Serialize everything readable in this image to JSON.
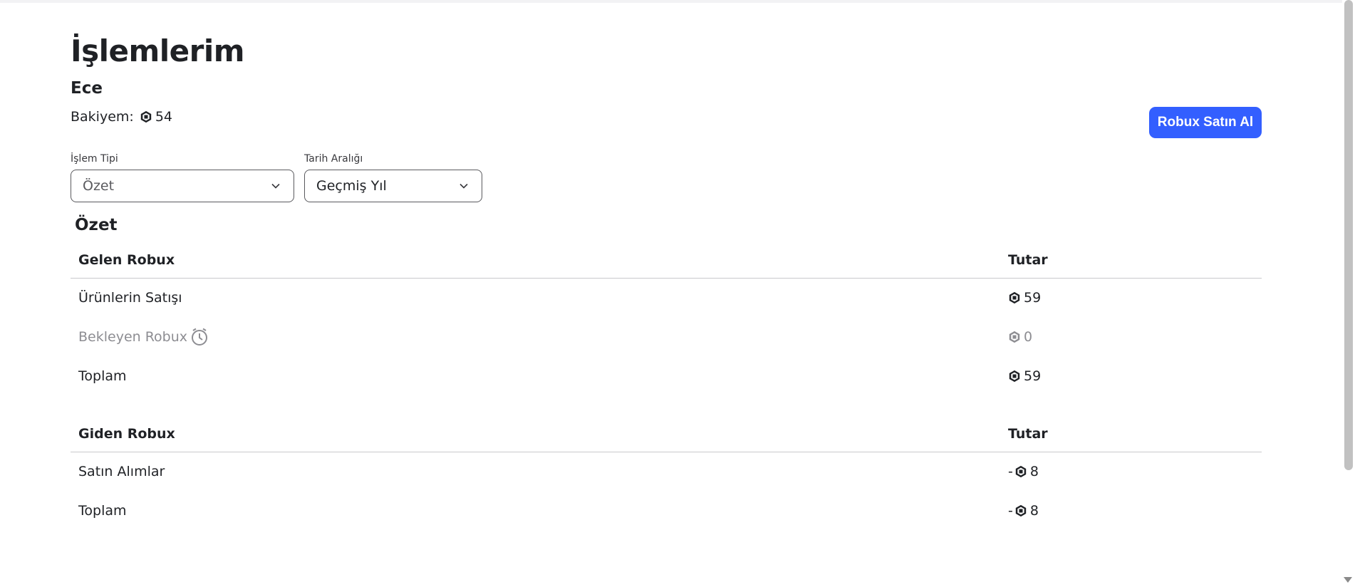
{
  "page": {
    "title": "İşlemlerim",
    "username": "Ece",
    "balance_label": "Bakiyem:",
    "balance_value": "54",
    "buy_button": "Robux Satın Al"
  },
  "filters": {
    "type_label": "İşlem Tipi",
    "type_value": "Özet",
    "date_label": "Tarih Aralığı",
    "date_value": "Geçmiş Yıl"
  },
  "summary": {
    "title": "Özet",
    "incoming": {
      "header": "Gelen Robux",
      "amount_header": "Tutar",
      "rows": [
        {
          "label": "Ürünlerin Satışı",
          "amount": "59"
        },
        {
          "label": "Bekleyen Robux",
          "amount": "0"
        },
        {
          "label": "Toplam",
          "amount": "59"
        }
      ]
    },
    "outgoing": {
      "header": "Giden Robux",
      "amount_header": "Tutar",
      "rows": [
        {
          "label": "Satın Alımlar",
          "sign": "-",
          "amount": "8"
        },
        {
          "label": "Toplam",
          "sign": "-",
          "amount": "8"
        }
      ]
    }
  },
  "icons": {
    "robux": "robux-icon",
    "pending": "clock-icon",
    "dropdown": "chevron-down-icon"
  },
  "colors": {
    "accent": "#335fff",
    "muted": "#8d8d92"
  }
}
